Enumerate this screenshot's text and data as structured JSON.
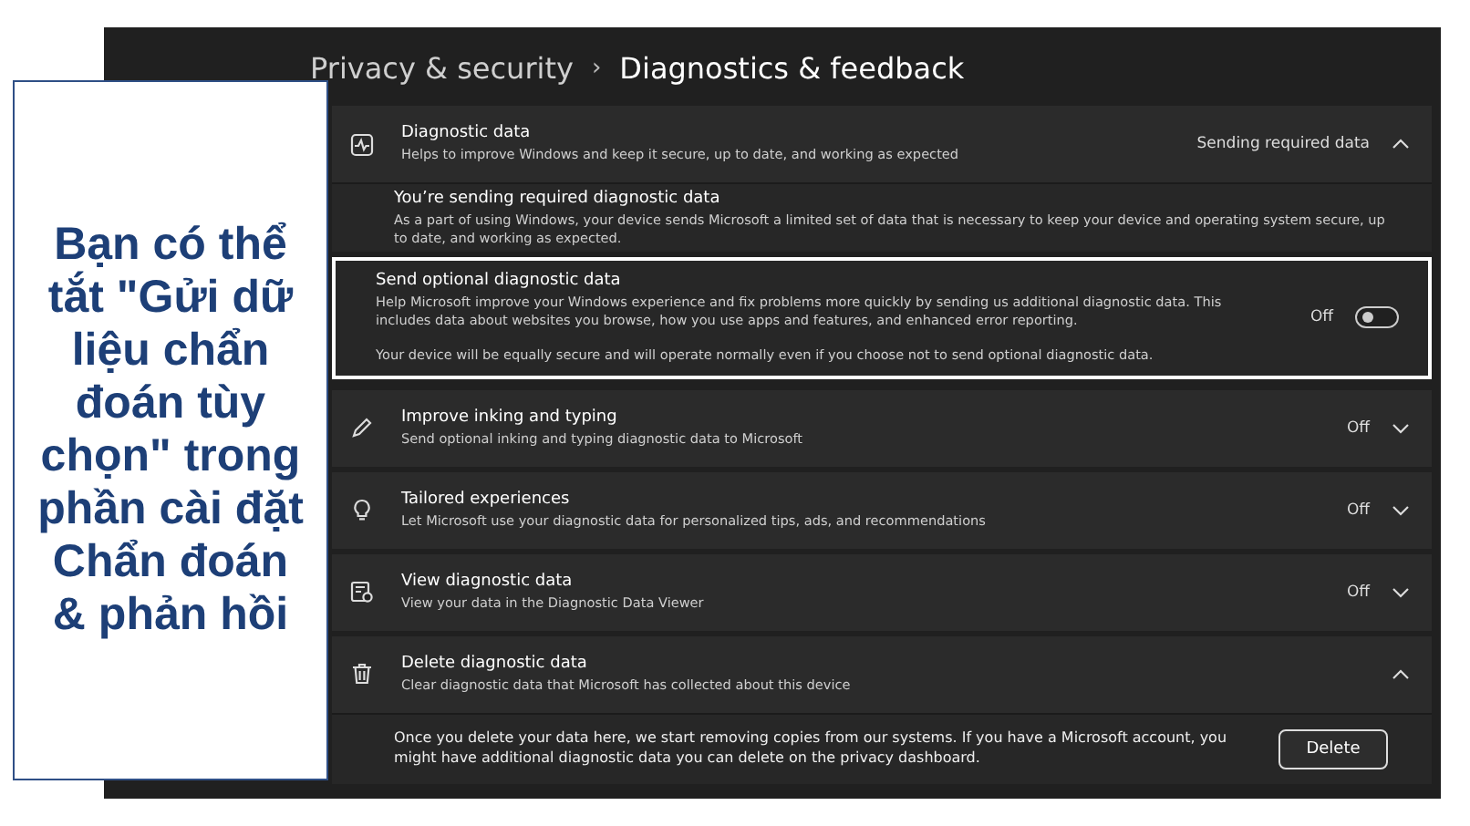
{
  "breadcrumb": {
    "parent": "Privacy & security",
    "separator": "›",
    "current": "Diagnostics & feedback"
  },
  "sections": [
    {
      "title": "Diagnostic data",
      "description": "Helps to improve Windows and keep it secure, up to date, and working as expected",
      "status": "Sending required data",
      "expanded": true,
      "details": [
        {
          "kind": "info",
          "title": "You’re sending required diagnostic data",
          "description": "As a part of using Windows, your device sends Microsoft a limited set of data that is necessary to keep your device and operating system secure, up to date, and working as expected."
        },
        {
          "kind": "toggle",
          "highlighted": true,
          "title": "Send optional diagnostic data",
          "description": "Help Microsoft improve your Windows experience and fix problems more quickly by sending us additional diagnostic data. This includes data about websites you browse, how you use apps and features, and enhanced error reporting.",
          "note": "Your device will be equally secure and will operate normally even if you choose not to send optional diagnostic data.",
          "toggle_label": "Off",
          "on": false
        }
      ]
    },
    {
      "title": "Improve inking and typing",
      "description": "Send optional inking and typing diagnostic data to Microsoft",
      "status": "Off",
      "expanded": false
    },
    {
      "title": "Tailored experiences",
      "description": "Let Microsoft use your diagnostic data for personalized tips, ads, and recommendations",
      "status": "Off",
      "expanded": false
    },
    {
      "title": "View diagnostic data",
      "description": "View your data in the Diagnostic Data Viewer",
      "status": "Off",
      "expanded": false
    },
    {
      "title": "Delete diagnostic data",
      "description": "Clear diagnostic data that Microsoft has collected about this device",
      "expanded": true,
      "details": [
        {
          "kind": "action",
          "description": "Once you delete your data here, we start removing copies from our systems. If you have a Microsoft account, you might have additional diagnostic data you can delete on the privacy dashboard.",
          "button": "Delete"
        }
      ]
    }
  ],
  "callout": {
    "text": "Bạn có thể tắt \"Gửi dữ liệu chẩn đoán tùy chọn\" trong phần cài đặt Chẩn đoán & phản hồi"
  }
}
